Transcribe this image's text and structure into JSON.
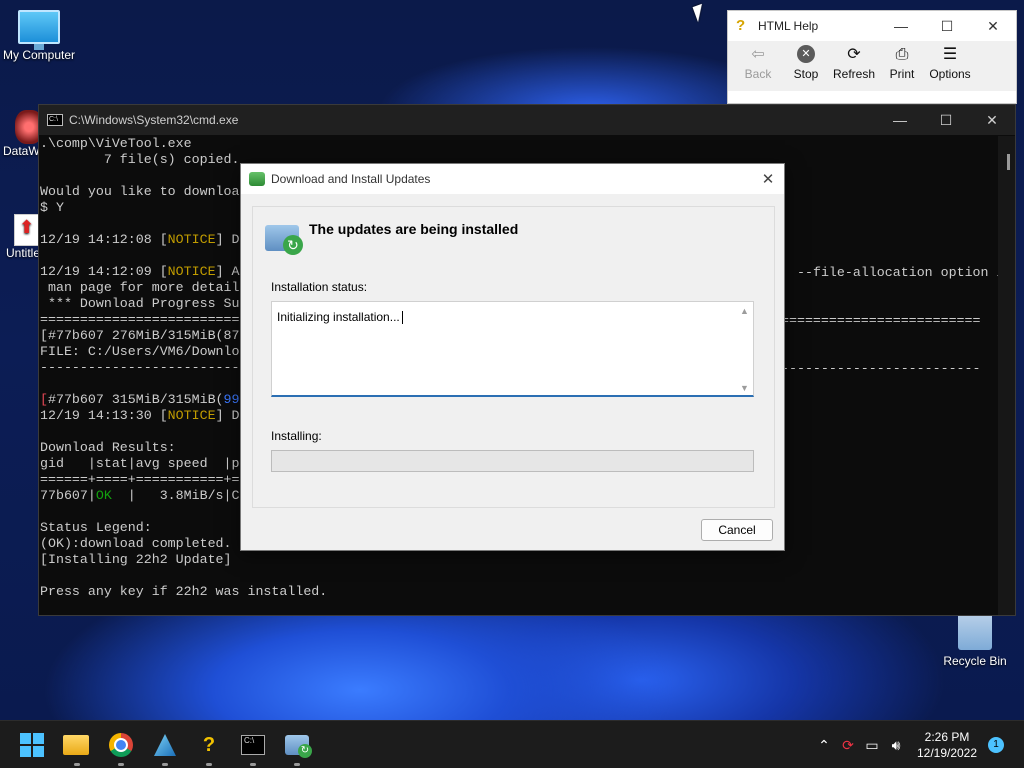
{
  "desktop": {
    "icons": [
      {
        "label": "My Computer"
      },
      {
        "label": "DataW"
      },
      {
        "label": "Untitle"
      },
      {
        "label": "Recycle Bin"
      }
    ]
  },
  "cmd_window": {
    "title": "C:\\Windows\\System32\\cmd.exe",
    "controls": {
      "minimize": "—",
      "maximize": "☐",
      "close": "✕"
    },
    "lines": [
      ".\\comp\\ViVeTool.exe",
      "        7 file(s) copied.",
      "",
      "Would you like to downloa",
      "$ Y",
      "",
      "12/19 14:12:08 [NOTICE] D",
      "",
      "12/19 14:12:09 [NOTICE] A",
      " man page for more detail",
      " *** Download Progress Su",
      "=========================",
      "[#77b607 276MiB/315MiB(87",
      "FILE: C:/Users/VM6/Downlo",
      "-------------------------",
      "",
      "[#77b607 315MiB/315MiB(99",
      "12/19 14:13:30 [NOTICE] D",
      "",
      "Download Results:",
      "gid   |stat|avg speed  |p",
      "======+====+===========+=",
      "77b607|OK  |   3.8MiB/s|C",
      "",
      "Status Legend:",
      "(OK):download completed.",
      "[Installing 22h2 Update]",
      "",
      "Press any key if 22h2 was installed."
    ],
    "right_fragments": {
      "line9": "--file-allocation option in",
      "line12": "===========================================================",
      "line15": "-----------------------------------------------------------"
    }
  },
  "help_window": {
    "title": "HTML Help",
    "controls": {
      "minimize": "—",
      "maximize": "☐",
      "close": "✕"
    },
    "toolbar": [
      {
        "label": "Back",
        "icon": "back-arrow-icon",
        "enabled": false
      },
      {
        "label": "Stop",
        "icon": "stop-icon",
        "enabled": true
      },
      {
        "label": "Refresh",
        "icon": "refresh-icon",
        "enabled": true
      },
      {
        "label": "Print",
        "icon": "printer-icon",
        "enabled": true
      },
      {
        "label": "Options",
        "icon": "options-icon",
        "enabled": true
      }
    ]
  },
  "dialog": {
    "title": "Download and Install Updates",
    "heading": "The updates are being installed",
    "status_label": "Installation status:",
    "status_text": "Initializing installation...",
    "installing_label": "Installing:",
    "progress_fraction": 0.0,
    "cancel_label": "Cancel"
  },
  "taskbar": {
    "apps": [
      "start-icon",
      "file-explorer-icon",
      "chrome-icon",
      "datawarrior-icon",
      "html-help-icon",
      "cmd-icon",
      "windows-update-icon"
    ],
    "clock_time": "2:26 PM",
    "clock_date": "12/19/2022",
    "notification_count": "1"
  }
}
